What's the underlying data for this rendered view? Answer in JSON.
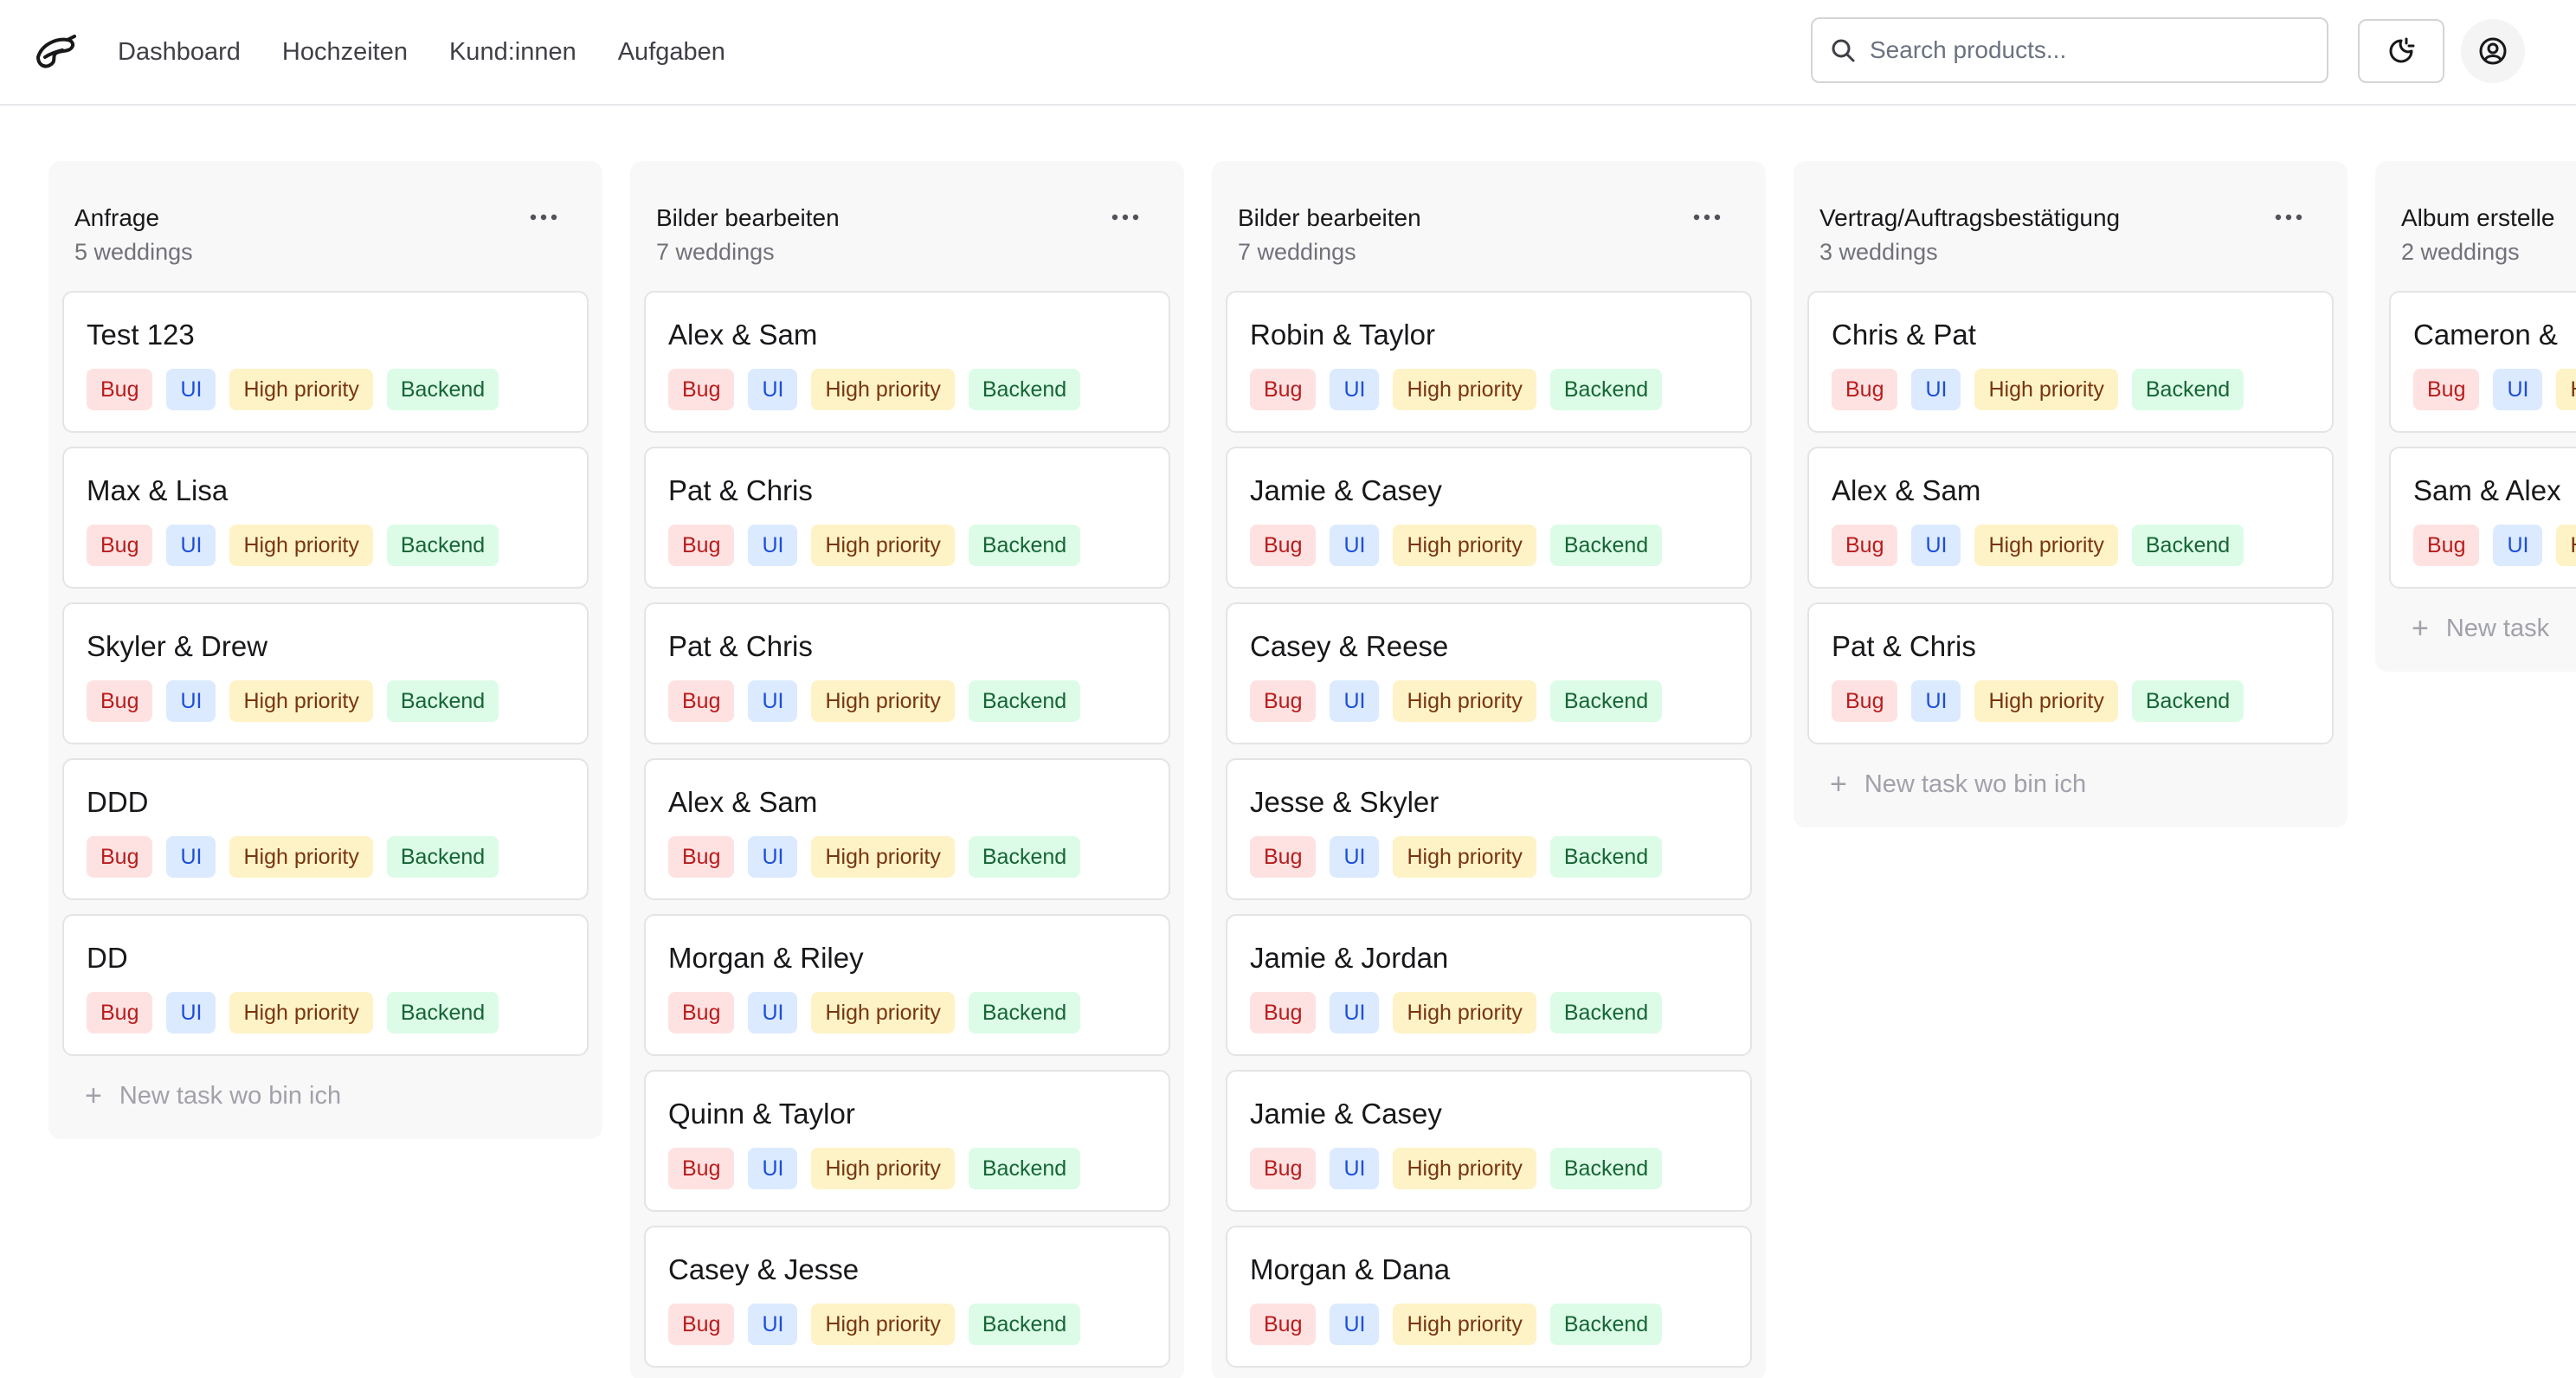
{
  "nav": {
    "links": [
      "Dashboard",
      "Hochzeiten",
      "Kund:innen",
      "Aufgaben"
    ]
  },
  "search": {
    "placeholder": "Search products..."
  },
  "tags": {
    "bug": "Bug",
    "ui": "UI",
    "priority": "High priority",
    "backend": "Backend"
  },
  "new_task_label": "New task wo bin ich",
  "columns": [
    {
      "title": "Anfrage",
      "count": "5 weddings",
      "cards": [
        "Test 123",
        "Max & Lisa",
        "Skyler & Drew",
        "DDD",
        "DD"
      ],
      "show_new_task": true
    },
    {
      "title": "Bilder bearbeiten",
      "count": "7 weddings",
      "cards": [
        "Alex & Sam",
        "Pat & Chris",
        "Pat & Chris",
        "Alex & Sam",
        "Morgan & Riley",
        "Quinn & Taylor",
        "Casey & Jesse"
      ],
      "show_new_task": false
    },
    {
      "title": "Bilder bearbeiten",
      "count": "7 weddings",
      "cards": [
        "Robin & Taylor",
        "Jamie & Casey",
        "Casey & Reese",
        "Jesse & Skyler",
        "Jamie & Jordan",
        "Jamie & Casey",
        "Morgan & Dana"
      ],
      "show_new_task": false
    },
    {
      "title": "Vertrag/Auftragsbestätigung",
      "count": "3 weddings",
      "cards": [
        "Chris & Pat",
        "Alex & Sam",
        "Pat & Chris"
      ],
      "show_new_task": true
    },
    {
      "title": "Album erstelle",
      "count": "2 weddings",
      "cards": [
        "Cameron &",
        "Sam & Alex"
      ],
      "new_task_label": "New task",
      "show_new_task": true
    }
  ],
  "colors": {
    "bug_bg": "#fee2e2",
    "bug_text": "#b91c1c",
    "ui_bg": "#dbeafe",
    "ui_text": "#1d4ed8",
    "priority_bg": "#fef3c7",
    "priority_text": "#78350f",
    "backend_bg": "#dcfce7",
    "backend_text": "#166534"
  },
  "icons": {
    "logo": "bird-logo-icon",
    "search": "search-icon",
    "theme": "moon-sun-toggle-icon",
    "user": "user-circle-icon",
    "more": "ellipsis-icon",
    "add": "plus-icon"
  }
}
